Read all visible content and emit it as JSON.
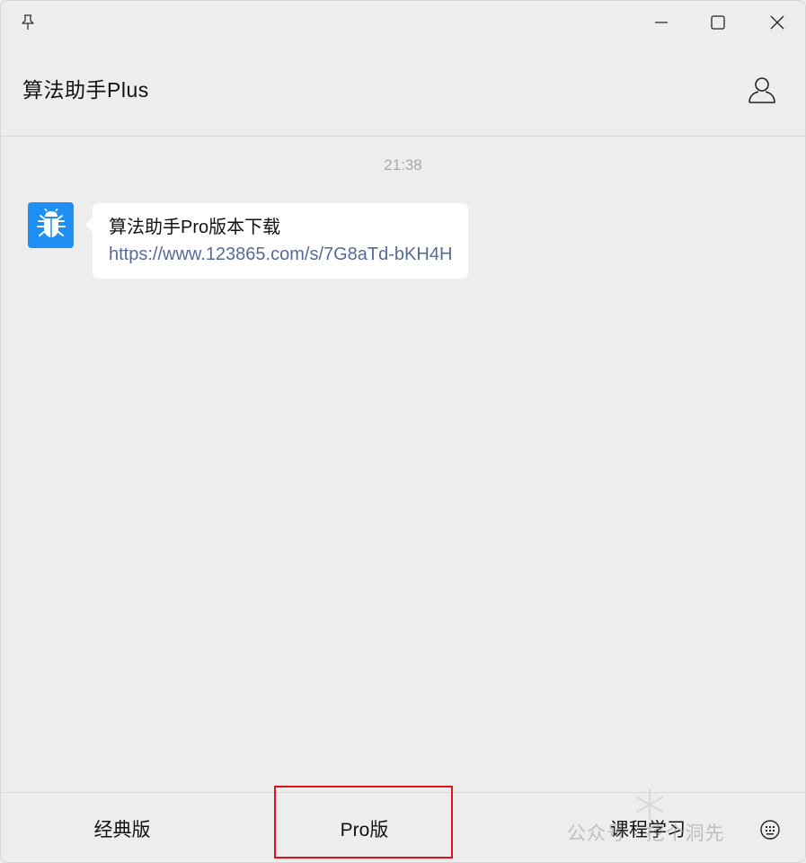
{
  "header": {
    "title": "算法助手Plus"
  },
  "chat": {
    "timestamp": "21:38",
    "messages": [
      {
        "avatar_icon": "bug-icon",
        "text": "算法助手Pro版本下载",
        "link": "https://www.123865.com/s/7G8aTd-bKH4H"
      }
    ]
  },
  "menu": {
    "items": [
      {
        "label": "经典版"
      },
      {
        "label": "Pro版"
      },
      {
        "label": "课程学习"
      }
    ]
  },
  "watermark": {
    "text": "公众号 · 挖个洞先"
  },
  "colors": {
    "background": "#ededed",
    "bubble": "#ffffff",
    "link": "#576b95",
    "avatar": "#1f8ff5",
    "highlight": "#e0121b"
  }
}
